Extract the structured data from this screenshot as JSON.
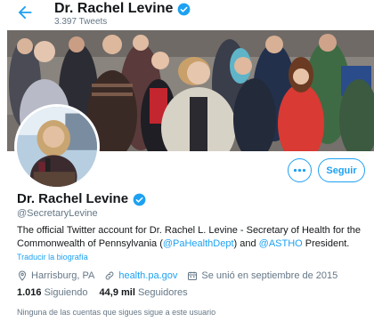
{
  "header": {
    "name": "Dr. Rachel Levine",
    "tweet_count": "3.397 Tweets"
  },
  "colors": {
    "accent": "#1da1f2",
    "secondary_text": "#657786",
    "primary_text": "#14171a"
  },
  "icons": {
    "back": "arrow-left-icon",
    "verified": "verified-badge-icon",
    "more": "more-dots-icon",
    "location": "location-pin-icon",
    "link": "link-icon",
    "calendar": "calendar-icon"
  },
  "actions": {
    "follow_label": "Seguir"
  },
  "profile": {
    "name": "Dr. Rachel Levine",
    "handle": "@SecretaryLevine",
    "bio_part1": "The official Twitter account for Dr. Rachel L. Levine - Secretary of Health for the Commonwealth of Pennsylvania (",
    "bio_mention1": "@PaHealthDept",
    "bio_part2": ") and ",
    "bio_mention2": "@ASTHO",
    "bio_part3": " President.",
    "translate_label": "Traducir la biografía",
    "location": "Harrisburg, PA",
    "website": "health.pa.gov",
    "joined": "Se unió en septiembre de 2015"
  },
  "stats": {
    "following_count": "1.016",
    "following_label": "Siguiendo",
    "followers_count": "44,9 mil",
    "followers_label": "Seguidores"
  },
  "followers_you_know": "Ninguna de las cuentas que sigues sigue a este usuario"
}
